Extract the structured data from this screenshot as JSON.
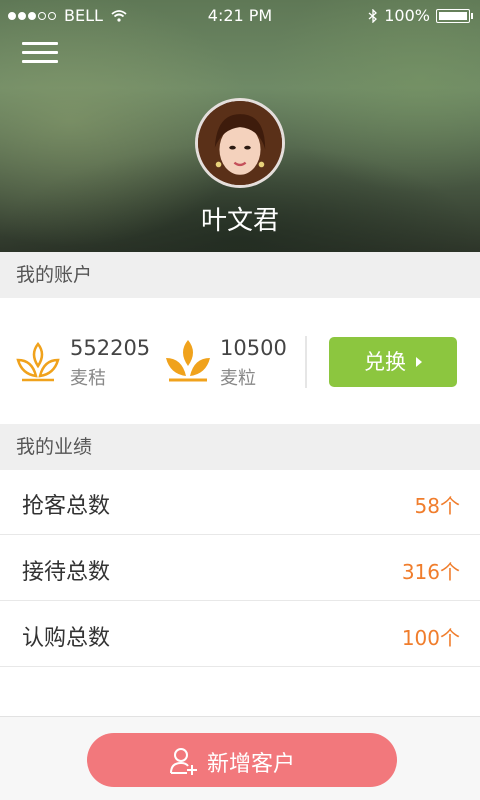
{
  "status_bar": {
    "carrier": "BELL",
    "time": "4:21 PM",
    "battery": "100%"
  },
  "header": {
    "user_name": "叶文君"
  },
  "account": {
    "section_title": "我的账户",
    "stat1": {
      "value": "552205",
      "label": "麦秸"
    },
    "stat2": {
      "value": "10500",
      "label": "麦粒"
    },
    "exchange_label": "兑换"
  },
  "performance": {
    "section_title": "我的业绩",
    "rows": [
      {
        "label": "抢客总数",
        "value": "58个"
      },
      {
        "label": "接待总数",
        "value": "316个"
      },
      {
        "label": "认购总数",
        "value": "100个"
      }
    ]
  },
  "bottom": {
    "add_customer_label": "新增客户"
  },
  "colors": {
    "exchange_button": "#8cc63f",
    "add_button": "#f2787c",
    "metric_value": "#f07d2c",
    "wheat_icon": "#f0a21c"
  }
}
